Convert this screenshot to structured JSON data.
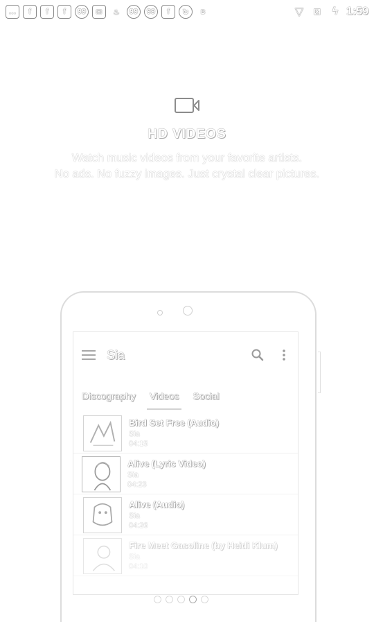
{
  "status_bar": {
    "left_icons": [
      {
        "name": "chat-notification-icon",
        "glyph": "…",
        "shape": "box"
      },
      {
        "name": "facebook-notification-icon",
        "glyph": "f",
        "shape": "box"
      },
      {
        "name": "facebook-notification-icon",
        "glyph": "f",
        "shape": "box"
      },
      {
        "name": "facebook-notification-icon",
        "glyph": "f",
        "shape": "box"
      },
      {
        "name": "quote-notification-icon",
        "glyph": "99",
        "shape": "round"
      },
      {
        "name": "mail-notification-icon",
        "glyph": "✉",
        "shape": "box"
      },
      {
        "name": "flame-notification-icon",
        "glyph": "♨",
        "shape": "plain"
      },
      {
        "name": "quote-notification-icon",
        "glyph": "99",
        "shape": "round"
      },
      {
        "name": "quote-notification-icon",
        "glyph": "99",
        "shape": "round"
      },
      {
        "name": "facebook-notification-icon",
        "glyph": "f",
        "shape": "box"
      },
      {
        "name": "sync-notification-icon",
        "glyph": "↻",
        "shape": "round"
      },
      {
        "name": "bluetooth-icon",
        "glyph": "ʙ",
        "shape": "plain"
      }
    ],
    "right_icons": [
      {
        "name": "wifi-icon",
        "glyph": "▽"
      },
      {
        "name": "no-sim-icon",
        "glyph": "⧄"
      },
      {
        "name": "battery-charging-icon",
        "glyph": "ϟ"
      }
    ],
    "time": "1:59"
  },
  "hero": {
    "icon": "video-camera-icon",
    "title": "HD VIDEOS",
    "desc_line1": "Watch music videos from your favorite artists.",
    "desc_line2": "No ads. No fuzzy images. Just crystal clear pictures."
  },
  "app": {
    "title": "Sia",
    "tabs": [
      "Discography",
      "Videos",
      "Social"
    ],
    "active_tab": "Videos",
    "videos": [
      {
        "title": "Bird Set Free (Audio)",
        "artist": "Sia",
        "duration": "04:15"
      },
      {
        "title": "Alive (Lyric Video)",
        "artist": "Sia",
        "duration": "04:23"
      },
      {
        "title": "Alive (Audio)",
        "artist": "Sia",
        "duration": "04:26"
      },
      {
        "title": "Fire Meet Gasoline (by Heidi Klum)",
        "artist": "Sia",
        "duration": "04:10"
      }
    ]
  },
  "pager": {
    "count": 5,
    "active_index": 3
  },
  "colors": {
    "background": "#ffffff",
    "outline": "#8f8f8f",
    "faint_outline": "#dcdcdc"
  }
}
